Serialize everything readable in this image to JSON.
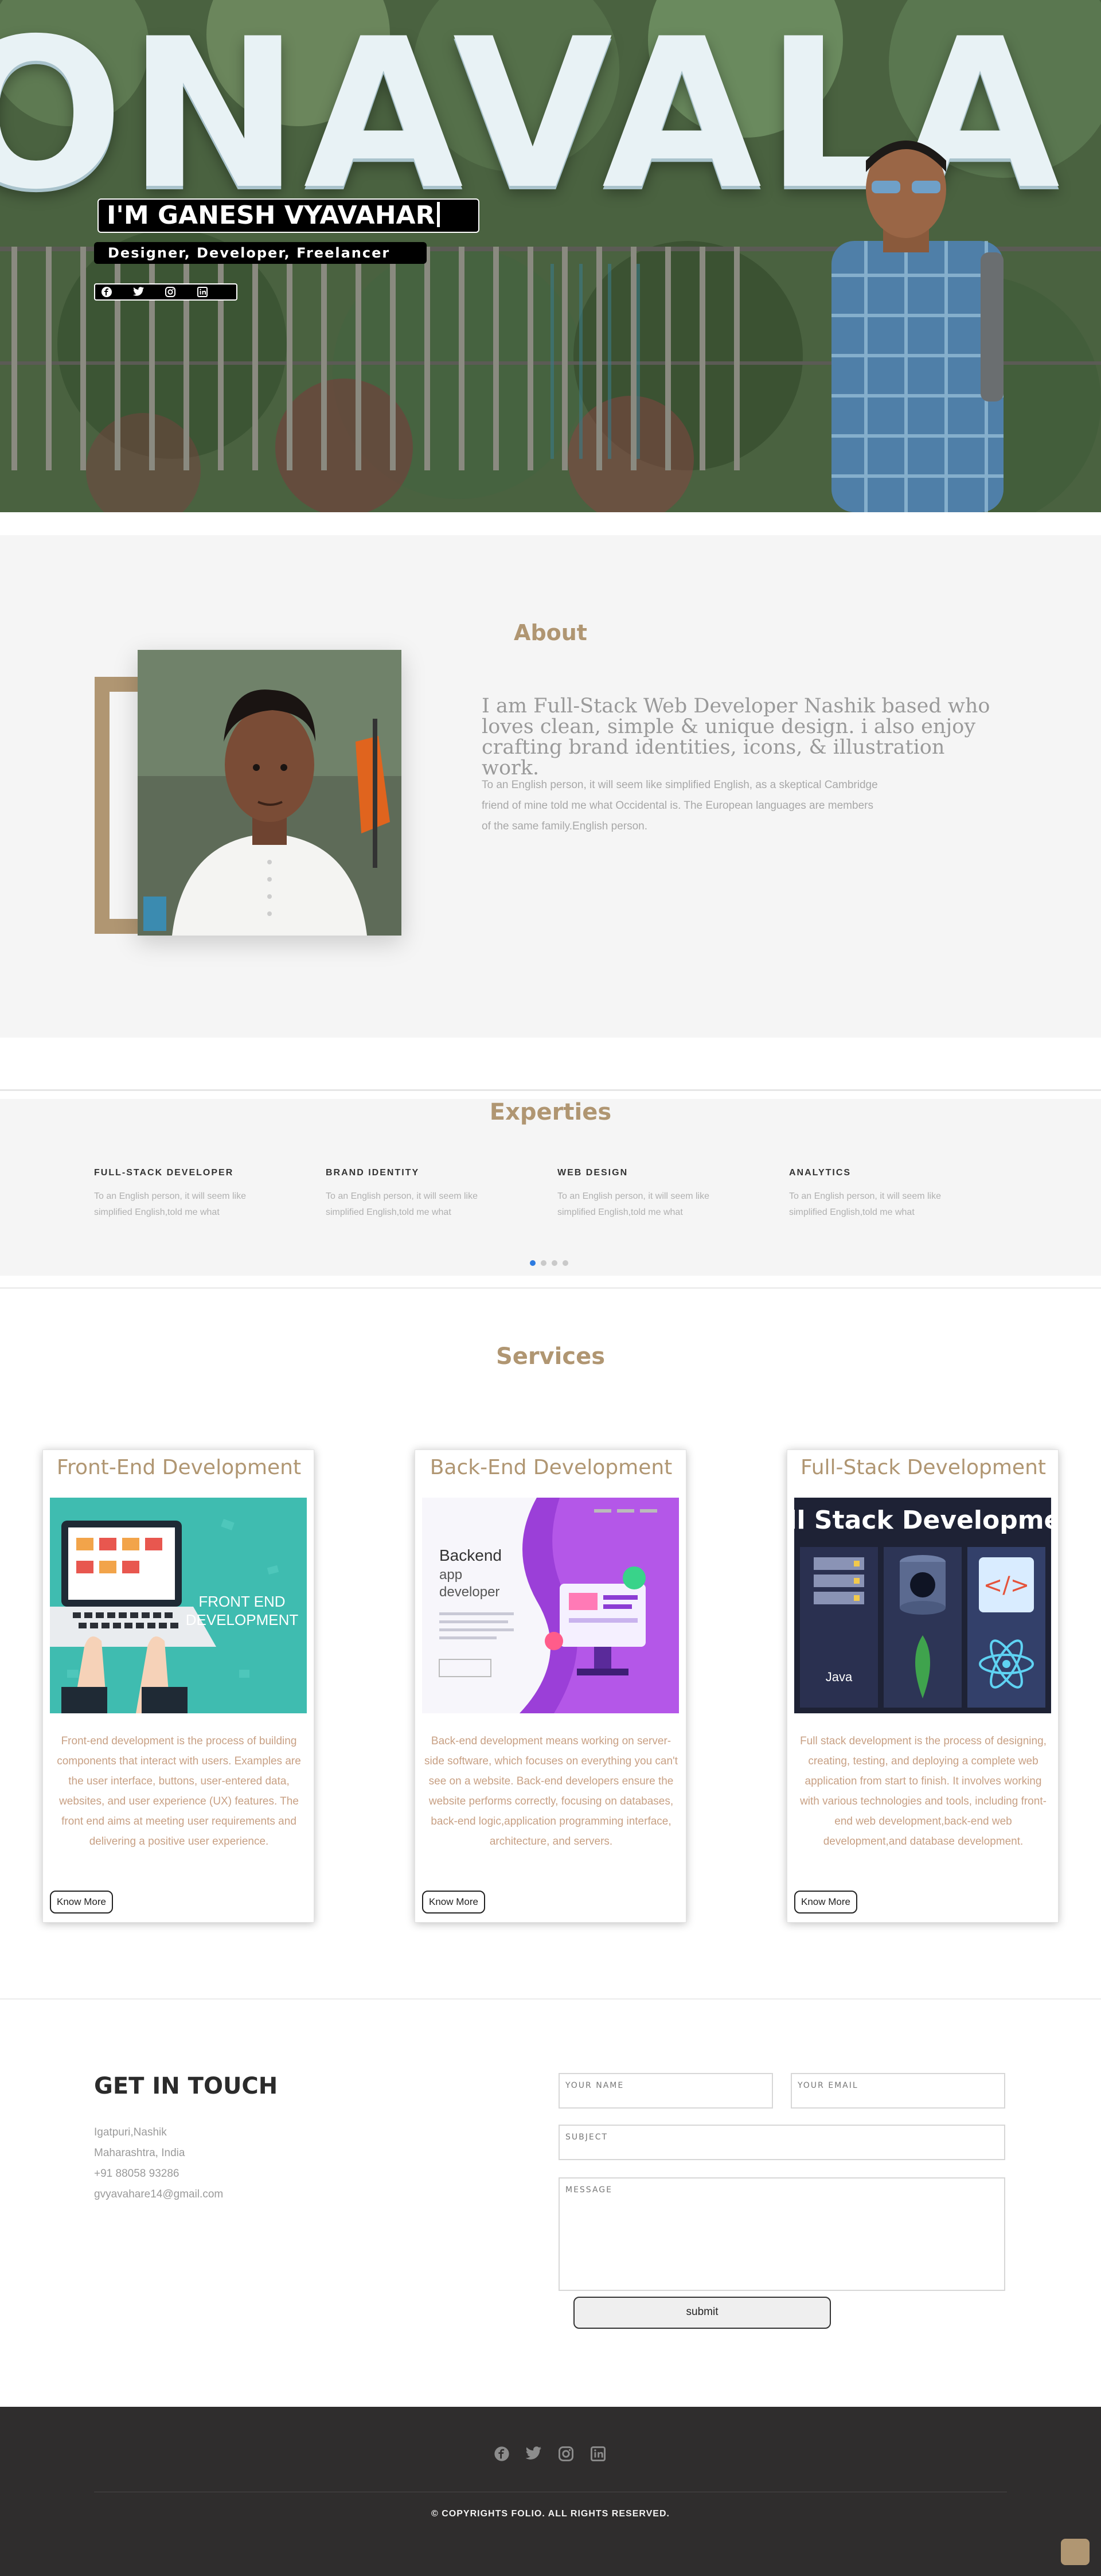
{
  "hero": {
    "background_text": "ONAVALA",
    "title": "I'M GANESH VYAVAHAR",
    "subtitle": "Designer, Developer, Freelancer",
    "social_icons": [
      "facebook-icon",
      "twitter-icon",
      "instagram-icon",
      "linkedin-icon"
    ]
  },
  "about": {
    "heading": "About",
    "lead": "I am Full-Stack Web Developer Nashik based who loves clean, simple & unique design. i also enjoy crafting brand identities, icons, & illustration work.",
    "body": "To an English person, it will seem like simplified English, as a skeptical Cambridge friend of mine told me what Occidental is. The European languages are members of the same family.English person."
  },
  "experties": {
    "heading": "Experties",
    "items": [
      {
        "title": "FULL-STACK DEVELOPER",
        "text": "To an English person, it will seem like simplified English,told me what"
      },
      {
        "title": "BRAND IDENTITY",
        "text": "To an English person, it will seem like simplified English,told me what"
      },
      {
        "title": "WEB DESIGN",
        "text": "To an English person, it will seem like simplified English,told me what"
      },
      {
        "title": "ANALYTICS",
        "text": "To an English person, it will seem like simplified English,told me what"
      }
    ],
    "carousel_pages": 4,
    "carousel_active": 1
  },
  "services": {
    "heading": "Services",
    "button_label": "Know More",
    "cards": [
      {
        "title": "Front-End Development",
        "image_text": "FRONT END DEVELOPMENT",
        "desc": "Front-end development is the process of building components that interact with users. Examples are the user interface, buttons, user-entered data, websites, and user experience (UX) features. The front end aims at meeting user requirements and delivering a positive user experience."
      },
      {
        "title": "Back-End Development",
        "image_text": "Backend app developer",
        "desc": "Back-end development means working on server-side software, which focuses on everything you can't see on a website. Back-end developers ensure the website performs correctly, focusing on databases, back-end logic,application programming interface, architecture, and servers."
      },
      {
        "title": "Full-Stack Development",
        "image_text": "Full Stack Development",
        "desc": "Full stack development is the process of designing, creating, testing, and deploying a complete web application from start to finish. It involves working with various technologies and tools, including front-end web development,back-end web development,and database development."
      }
    ]
  },
  "contact": {
    "heading": "GET IN TOUCH",
    "lines": [
      "Igatpuri,Nashik",
      "Maharashtra, India",
      "+91 88058 93286",
      "gvyavahare14@gmail.com"
    ],
    "name_placeholder": "YOUR NAME",
    "email_placeholder": "YOUR EMAIL",
    "subject_placeholder": "SUBJECT",
    "message_placeholder": "MESSAGE",
    "submit_label": "submit"
  },
  "footer": {
    "icons": [
      "facebook-icon",
      "twitter-icon",
      "instagram-icon",
      "linkedin-icon"
    ],
    "copyright": "© COPYRIGHTS FOLIO. ALL RIGHTS RESERVED."
  },
  "colors": {
    "accent": "#b09672",
    "footer_bg": "#2f2d2d",
    "section_bg": "#f5f5f5",
    "carousel_active": "#2d7be0"
  }
}
